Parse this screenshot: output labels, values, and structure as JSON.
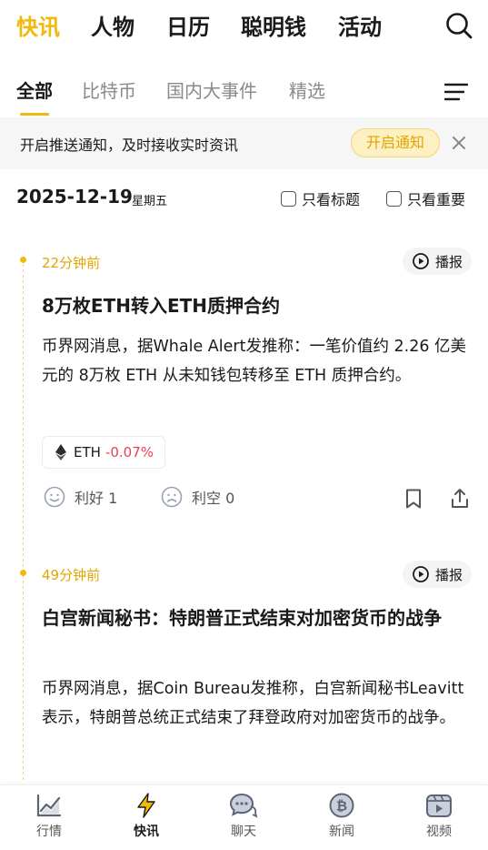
{
  "top_tabs": [
    "快讯",
    "人物",
    "日历",
    "聪明钱",
    "活动"
  ],
  "sub_tabs": [
    "全部",
    "比特币",
    "国内大事件",
    "精选"
  ],
  "banner": {
    "text": "开启推送通知，及时接收实时资讯",
    "button": "开启通知"
  },
  "date": {
    "value": "2025-12-19",
    "weekday": "星期五"
  },
  "filters": {
    "title_only": "只看标题",
    "important_only": "只看重要"
  },
  "news": [
    {
      "time": "22分钟前",
      "play": "播报",
      "title": "8万枚ETH转入ETH质押合约",
      "body": "币界网消息，据Whale Alert发推称：一笔价值约 2.26 亿美元的 8万枚 ETH 从未知钱包转移至 ETH 质押合约。",
      "tag": {
        "symbol": "ETH",
        "change": "-0.07%"
      },
      "bullish": "利好 1",
      "bearish": "利空 0"
    },
    {
      "time": "49分钟前",
      "play": "播报",
      "title": "白宫新闻秘书：特朗普正式结束对加密货币的战争",
      "body": "币界网消息，据Coin Bureau发推称，白宫新闻秘书Leavitt表示，特朗普总统正式结束了拜登政府对加密货币的战争。"
    }
  ],
  "bottom_nav": [
    "行情",
    "快讯",
    "聊天",
    "新闻",
    "视频"
  ],
  "colors": {
    "accent": "#f0b90b",
    "negative": "#e8424f"
  }
}
